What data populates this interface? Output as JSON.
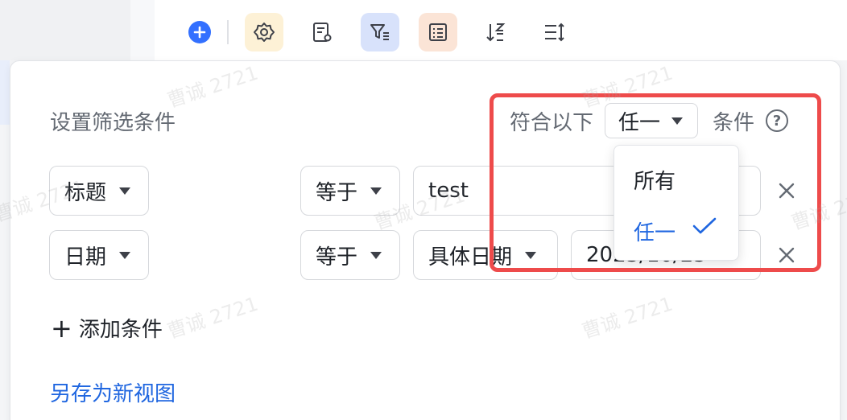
{
  "colors": {
    "accent": "#1f66e0",
    "highlight": "#ee4b4b",
    "text": "#1f2329",
    "muted": "#646a73"
  },
  "toolbar": {
    "items": [
      "add-icon",
      "gear-icon",
      "record-settings-icon",
      "filter-icon",
      "fields-icon",
      "sort-icon",
      "row-height-icon"
    ]
  },
  "panel": {
    "title": "设置筛选条件",
    "match_prefix": "符合以下",
    "match_value": "任一",
    "match_suffix": "条件",
    "help_glyph": "?",
    "conditions": [
      {
        "field": "标题",
        "operator": "等于",
        "value": "test"
      },
      {
        "field": "日期",
        "operator": "等于",
        "date_mode": "具体日期",
        "value": "2023/10/25"
      }
    ],
    "add_condition": "添加条件",
    "save_view": "另存为新视图"
  },
  "dropdown": {
    "options": [
      {
        "label": "所有",
        "selected": false
      },
      {
        "label": "任一",
        "selected": true
      }
    ]
  },
  "watermark": "曹诚 2721"
}
